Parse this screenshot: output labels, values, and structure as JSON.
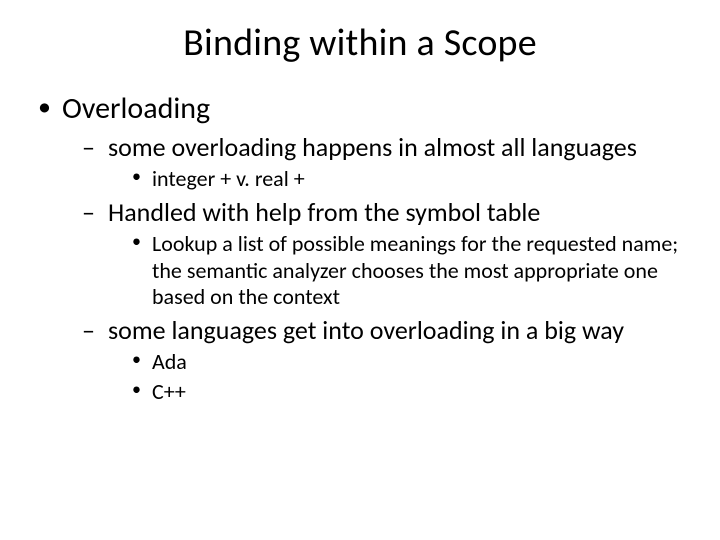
{
  "title": "Binding within a Scope",
  "l1": {
    "item0": "Overloading",
    "sub": {
      "item0": "some overloading happens in almost all languages",
      "item0_sub": {
        "a": "integer + v. real +"
      },
      "item1": "Handled with help from the symbol table",
      "item1_sub": {
        "a": "Lookup a list of possible meanings for the requested name; the semantic analyzer chooses the most appropriate one based on the context"
      },
      "item2": "some languages get into overloading in a big way",
      "item2_sub": {
        "a": "Ada",
        "b": "C++"
      }
    }
  }
}
